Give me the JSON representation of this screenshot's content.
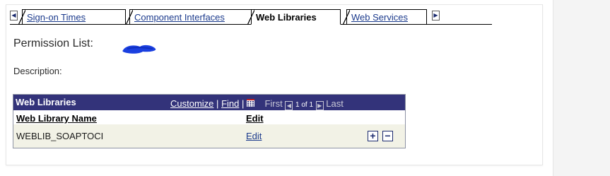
{
  "tabs": {
    "scroll_left": "◀",
    "scroll_right": "▶",
    "items": [
      {
        "label_key": "S",
        "label_rest": "ign-on Times"
      },
      {
        "label_key": "C",
        "label_rest": "omponent Interfaces"
      },
      {
        "label": "Web Libraries"
      },
      {
        "label_pre": "We",
        "label_key": "b",
        "label_rest": " Services"
      }
    ]
  },
  "form": {
    "permission_label": "Permission List:",
    "description_label": "Description:"
  },
  "grid": {
    "title": "Web Libraries",
    "customize": "Customize",
    "sep1": "|",
    "find": "Find",
    "sep2": "|",
    "first": "First",
    "prev_icon": "◀",
    "range": "1 of 1",
    "next_icon": "▶",
    "last": "Last",
    "columns": [
      "Web Library Name",
      "Edit"
    ],
    "rows": [
      {
        "name": "WEBLIB_SOAPTOCI",
        "edit": "Edit"
      }
    ],
    "add_icon": "+",
    "delete_icon": "−"
  },
  "colors": {
    "header_bg": "#33337a",
    "link": "#1b3a8c",
    "row_bg": "#f2f2e6",
    "redaction": "#1a3fe0"
  }
}
